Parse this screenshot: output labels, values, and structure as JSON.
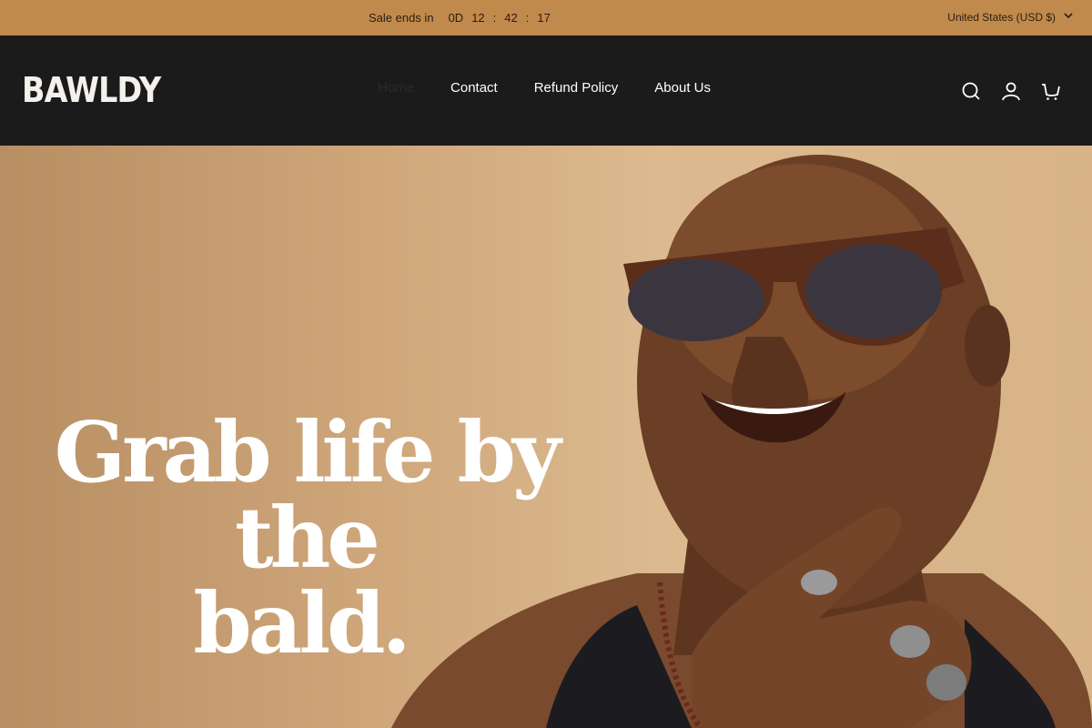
{
  "announcement": {
    "sale_label": "Sale ends in",
    "timer": {
      "days": "0D",
      "hours": "12",
      "minutes": "42",
      "seconds": "17"
    },
    "currency": "United States (USD $)"
  },
  "header": {
    "logo": "BAWLDY",
    "nav": [
      "Home",
      "Contact",
      "Refund Policy",
      "About Us"
    ],
    "icons": [
      "search-icon",
      "account-icon",
      "cart-icon"
    ]
  },
  "hero": {
    "headline_line1": "Grab life by the",
    "headline_line2": "bald."
  },
  "colors": {
    "announcement_bg": "#c08a4c",
    "header_bg": "#1b1b1b",
    "hero_bg": "#d2ad82"
  }
}
